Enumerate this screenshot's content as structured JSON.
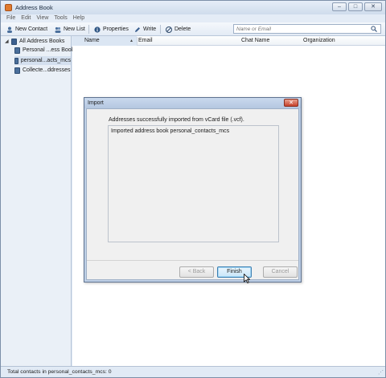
{
  "window": {
    "title": "Address Book"
  },
  "window_controls": {
    "minimize": "–",
    "maximize": "□",
    "close": "✕"
  },
  "menu": [
    "File",
    "Edit",
    "View",
    "Tools",
    "Help"
  ],
  "toolbar": {
    "new_contact": "New Contact",
    "new_list": "New List",
    "properties": "Properties",
    "write": "Write",
    "delete": "Delete"
  },
  "search": {
    "placeholder": "Name or Email"
  },
  "sidebar": {
    "root": "All Address Books",
    "items": [
      "Personal ...ess Book",
      "personal...acts_mcs",
      "Collecte...ddresses"
    ],
    "selected_index": 1
  },
  "columns": [
    "Name",
    "Email",
    "Chat Name",
    "Organization"
  ],
  "status": {
    "text": "Total contacts in personal_contacts_mcs: 0"
  },
  "dialog": {
    "title": "Import",
    "message": "Addresses successfully imported from vCard file (.vcf).",
    "list_items": [
      "Imported address book personal_contacts_mcs"
    ],
    "back": "< Back",
    "finish": "Finish",
    "cancel": "Cancel"
  },
  "colors": {
    "accent": "#3c7fb1",
    "window_bg": "#dfe9f5",
    "dialog_bg": "#bfd0e6"
  }
}
